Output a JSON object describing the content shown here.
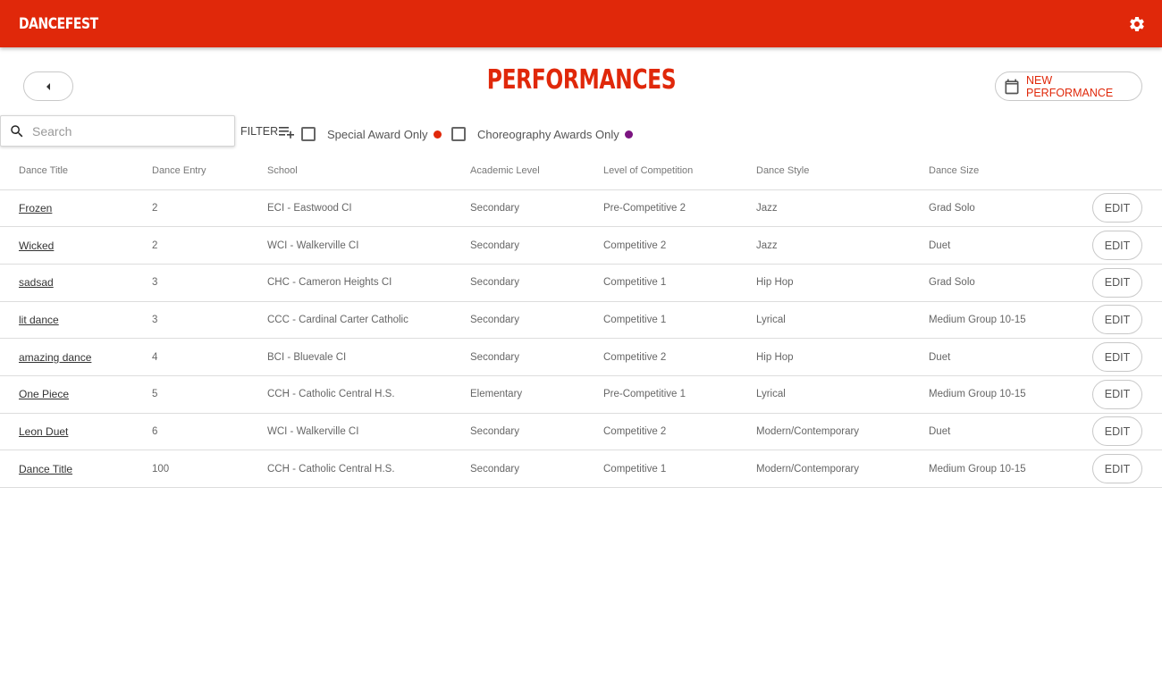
{
  "appbar": {
    "brand": "DANCEFEST",
    "settings_icon": "gear-icon"
  },
  "page": {
    "title": "PERFORMANCES",
    "back_icon": "caret-left-icon"
  },
  "new_performance": {
    "label": "NEW PERFORMANCE",
    "icon": "calendar-icon"
  },
  "search": {
    "placeholder": "Search",
    "value": "",
    "icon": "search-icon"
  },
  "filter": {
    "label": "FILTER",
    "icon": "playlist-add-icon"
  },
  "checkboxes": [
    {
      "label": "Special Award Only",
      "checked": false,
      "dot_color": "#e0280a"
    },
    {
      "label": "Choreography Awards Only",
      "checked": false,
      "dot_color": "#7b1480"
    }
  ],
  "table": {
    "columns": [
      "Dance Title",
      "Dance Entry",
      "School",
      "Academic Level",
      "Level of Competition",
      "Dance Style",
      "Dance Size"
    ],
    "edit_label": "EDIT",
    "rows": [
      {
        "title": "Frozen",
        "entry": "2",
        "school": "ECI - Eastwood CI",
        "academic": "Secondary",
        "competition": "Pre-Competitive 2",
        "style": "Jazz",
        "size": "Grad Solo"
      },
      {
        "title": "Wicked",
        "entry": "2",
        "school": "WCI - Walkerville CI",
        "academic": "Secondary",
        "competition": "Competitive 2",
        "style": "Jazz",
        "size": "Duet"
      },
      {
        "title": "sadsad",
        "entry": "3",
        "school": "CHC - Cameron Heights CI",
        "academic": "Secondary",
        "competition": "Competitive 1",
        "style": "Hip Hop",
        "size": "Grad Solo"
      },
      {
        "title": "lit dance",
        "entry": "3",
        "school": "CCC - Cardinal Carter Catholic",
        "academic": "Secondary",
        "competition": "Competitive 1",
        "style": "Lyrical",
        "size": "Medium Group 10-15"
      },
      {
        "title": "amazing dance",
        "entry": "4",
        "school": "BCI - Bluevale CI",
        "academic": "Secondary",
        "competition": "Competitive 2",
        "style": "Hip Hop",
        "size": "Duet"
      },
      {
        "title": "One Piece",
        "entry": "5",
        "school": "CCH - Catholic Central H.S.",
        "academic": "Elementary",
        "competition": "Pre-Competitive 1",
        "style": "Lyrical",
        "size": "Medium Group 10-15"
      },
      {
        "title": "Leon Duet",
        "entry": "6",
        "school": "WCI - Walkerville CI",
        "academic": "Secondary",
        "competition": "Competitive 2",
        "style": "Modern/Contemporary",
        "size": "Duet"
      },
      {
        "title": "Dance Title",
        "entry": "100",
        "school": "CCH - Catholic Central H.S.",
        "academic": "Secondary",
        "competition": "Competitive 1",
        "style": "Modern/Contemporary",
        "size": "Medium Group 10-15"
      }
    ]
  },
  "colors": {
    "brand": "#e0280a",
    "choreography": "#7b1480"
  }
}
